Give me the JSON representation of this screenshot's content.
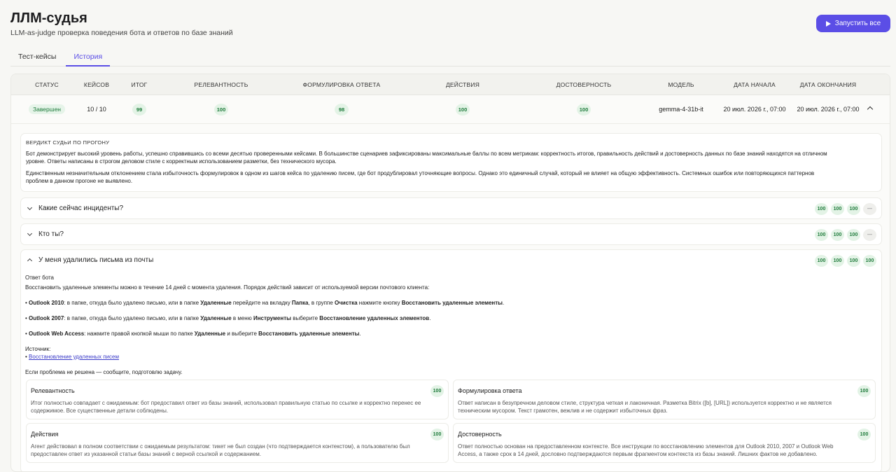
{
  "header": {
    "title": "ЛЛМ-судья",
    "subtitle": "LLM-as-judge проверка поведения бота и ответов по базе знаний",
    "run_all_label": "Запустить все"
  },
  "tabs": [
    {
      "label": "Тест-кейсы",
      "active": false
    },
    {
      "label": "История",
      "active": true
    }
  ],
  "table": {
    "columns": [
      "СТАТУС",
      "КЕЙСОВ",
      "ИТОГ",
      "РЕЛЕВАНТНОСТЬ",
      "ФОРМУЛИРОВКА ОТВЕТА",
      "ДЕЙСТВИЯ",
      "ДОСТОВЕРНОСТЬ",
      "МОДЕЛЬ",
      "ДАТА НАЧАЛА",
      "ДАТА ОКОНЧАНИЯ"
    ],
    "row": {
      "status": "Завершен",
      "cases": "10 / 10",
      "total": "99",
      "relevance": "100",
      "wording": "98",
      "actions": "100",
      "reliability": "100",
      "model": "gemma-4-31b-it",
      "start": "20 июл. 2026 г., 07:00",
      "end": "20 июл. 2026 г., 07:00"
    }
  },
  "verdict": {
    "title": "ВЕРДИКТ СУДЬИ ПО ПРОГОНУ",
    "p1_l1": "Бот демонстрирует высокий уровень работы, успешно справившись со всеми десятью проверенными кейсами. В большинстве сценариев зафиксированы максимальные баллы по всем метрикам: корректность итогов, правильность действий и достоверность данных по базе знаний находятся на отличном",
    "p1_l2": "уровне. Ответы написаны в строгом деловом стиле с корректным использованием разметки, без технического мусора.",
    "p2_l1": "Единственным незначительным отклонением стала избыточность формулировок в одном из шагов кейса по удалению писем, где бот продублировал уточняющие вопросы. Однако это единичный случай, который не влияет на общую эффективность. Системных ошибок или повторяющихся паттернов",
    "p2_l2": "проблем в данном прогоне не выявлено."
  },
  "cases": [
    {
      "question": "Какие сейчас инциденты?",
      "scores": [
        "100",
        "100",
        "100",
        "—"
      ]
    },
    {
      "question": "Кто ты?",
      "scores": [
        "100",
        "100",
        "100",
        "—"
      ]
    },
    {
      "question": "У меня удалились письма из почты",
      "scores": [
        "100",
        "100",
        "100",
        "100"
      ]
    }
  ],
  "answer": {
    "label": "Ответ бота",
    "intro": "Восстановить удаленные элементы можно в течение 14 дней с момента удаления. Порядок действий зависит от используемой версии почтового клиента:",
    "b1": {
      "a": "Outlook 2010",
      "b": ": в папке, откуда было удалено письмо, или в папке ",
      "c": "Удаленные",
      "d": " перейдите на вкладку ",
      "e": "Папка",
      "f": ", в группе ",
      "g": "Очистка",
      "h": " нажмите кнопку ",
      "i": "Восстановить удаленные элементы",
      "j": "."
    },
    "b2": {
      "a": "Outlook 2007",
      "b": ": в папке, откуда было удалено письмо, или в папке ",
      "c": "Удаленные",
      "d": " в меню ",
      "e": "Инструменты",
      "f": " выберите ",
      "g": "Восстановление удаленных элементов",
      "h": "."
    },
    "b3": {
      "a": "Outlook Web Access",
      "b": ": нажмите правой кнопкой мыши по папке ",
      "c": "Удаленные",
      "d": " и выберите ",
      "e": "Восстановить удаленные элементы",
      "f": "."
    },
    "source_label": "Источник:",
    "source_link": "Восстановление удаленных писем",
    "closing": "Если проблема не решена — сообщите, подготовлю задачу."
  },
  "criteria": [
    {
      "title": "Релевантность",
      "score": "100",
      "l1": "Итог полностью совпадает с ожидаемым: бот предоставил ответ из базы знаний, использовал правильную статью по ссылке и корректно перенес ее",
      "l2": "содержимое. Все существенные детали соблюдены."
    },
    {
      "title": "Формулировка ответа",
      "score": "100",
      "l1": "Ответ написан в безупречном деловом стиле, структура четкая и лаконичная. Разметка Bitrix ([b], [URL]) используется корректно и не является",
      "l2": "техническим мусором. Текст грамотен, вежлив и не содержит избыточных фраз."
    },
    {
      "title": "Действия",
      "score": "100",
      "l1": "Агент действовал в полном соответствии с ожидаемым результатом: тикет не был создан (что подтверждается контекстом), а пользователю был",
      "l2": "предоставлен ответ из указанной статьи базы знаний с верной ссылкой и содержанием."
    },
    {
      "title": "Достоверность",
      "score": "100",
      "l1": "Ответ полностью основан на предоставленном контексте. Все инструкции по восстановлению элементов для Outlook 2010, 2007 и Outlook Web",
      "l2": "Access, а также срок в 14 дней, дословно подтверждаются первым фрагментом контекста из базы знаний. Лишних фактов не добавлено."
    }
  ]
}
